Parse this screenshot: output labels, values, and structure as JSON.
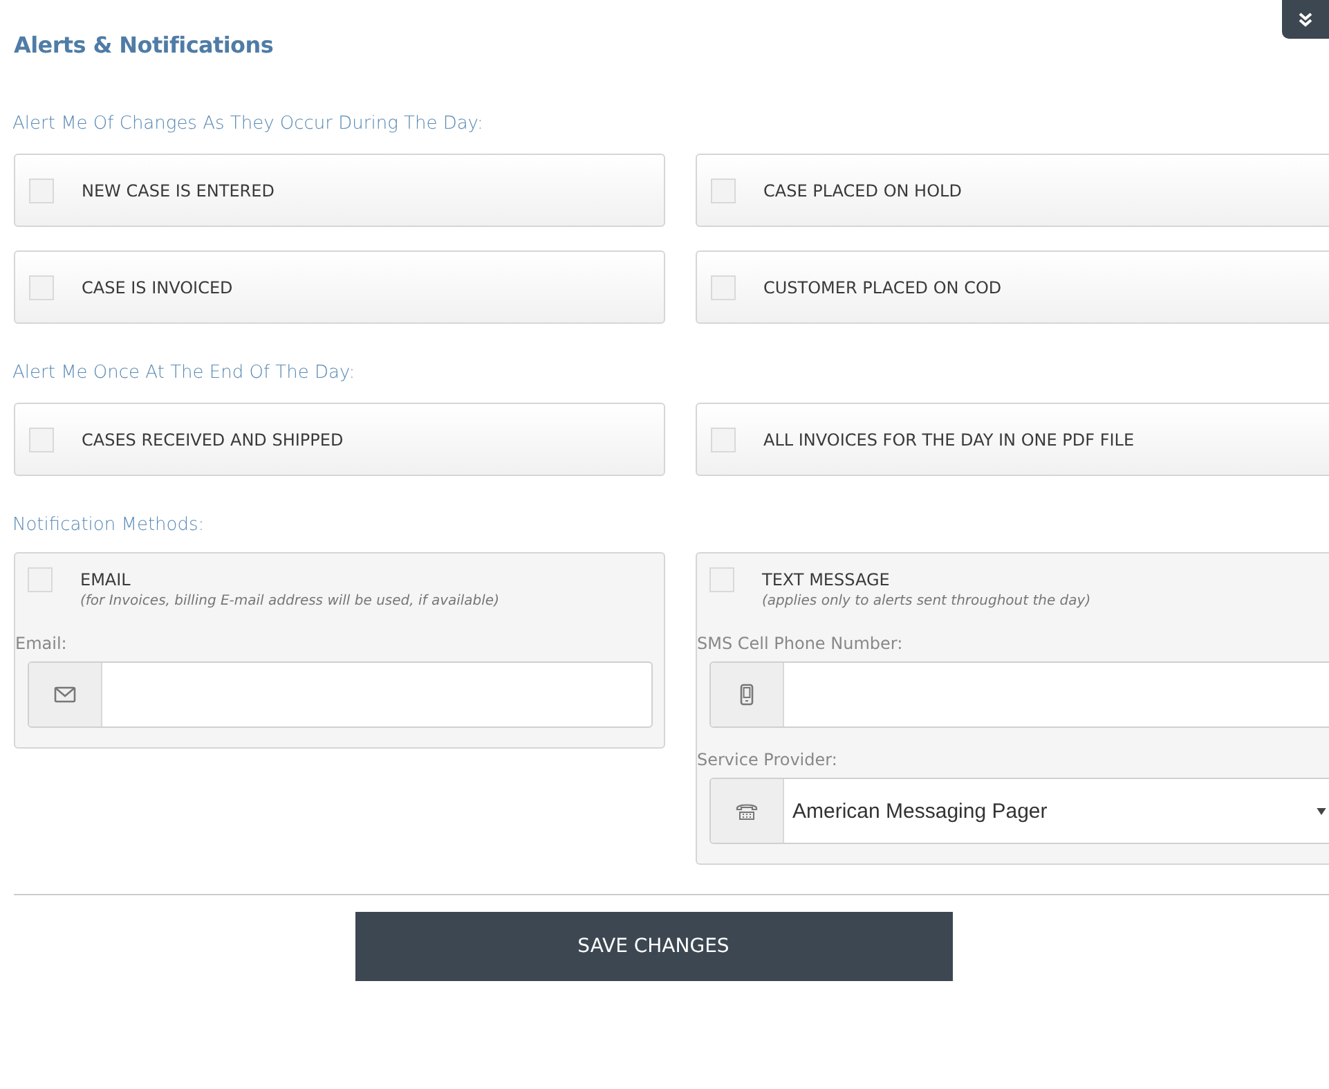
{
  "title": "Alerts & Notifications",
  "sections": [
    {
      "heading": "Alert Me Of Changes As They Occur During The Day:",
      "options": [
        {
          "label": "NEW CASE IS ENTERED",
          "checked": false
        },
        {
          "label": "CASE PLACED ON HOLD",
          "checked": false
        },
        {
          "label": "CASE IS INVOICED",
          "checked": false
        },
        {
          "label": "CUSTOMER PLACED ON COD",
          "checked": false
        }
      ]
    },
    {
      "heading": "Alert Me Once At The End Of The Day:",
      "options": [
        {
          "label": "CASES RECEIVED AND SHIPPED",
          "checked": false
        },
        {
          "label": "ALL INVOICES FOR THE DAY IN ONE PDF FILE",
          "checked": false
        }
      ]
    }
  ],
  "methods_heading": "Notification Methods:",
  "methods": [
    {
      "label": "EMAIL",
      "checked": false,
      "note": "(for Invoices, billing E-mail address will be used, if available)",
      "fields": [
        {
          "kind": "input",
          "label": "Email:"
        }
      ]
    },
    {
      "label": "TEXT MESSAGE",
      "checked": false,
      "note": "(applies only to alerts sent throughout the day)",
      "fields": [
        {
          "kind": "input",
          "label": "SMS Cell Phone Number:"
        },
        {
          "kind": "select",
          "label": "Service Provider:",
          "value": "American Messaging Pager"
        }
      ]
    }
  ],
  "save_button": "SAVE CHANGES"
}
